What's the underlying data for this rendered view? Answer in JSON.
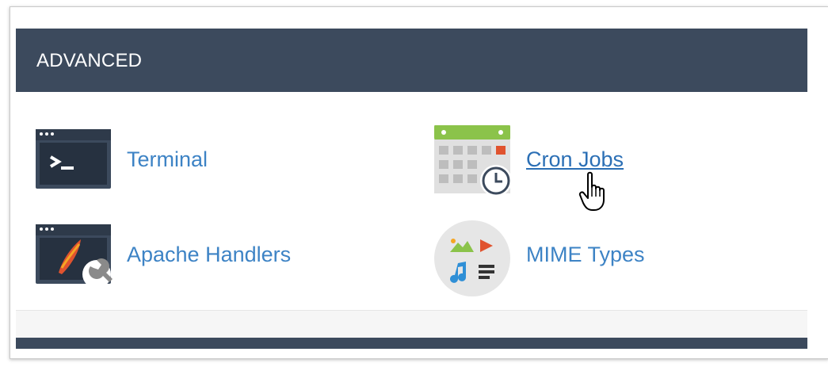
{
  "section": {
    "title": "ADVANCED"
  },
  "items": [
    {
      "label": "Terminal",
      "icon": "terminal-icon"
    },
    {
      "label": "Cron Jobs",
      "icon": "calendar-clock-icon"
    },
    {
      "label": "Apache Handlers",
      "icon": "apache-handlers-icon"
    },
    {
      "label": "MIME Types",
      "icon": "mime-types-icon"
    }
  ],
  "colors": {
    "header_bg": "#3c4a5d",
    "link": "#3d83c5"
  }
}
